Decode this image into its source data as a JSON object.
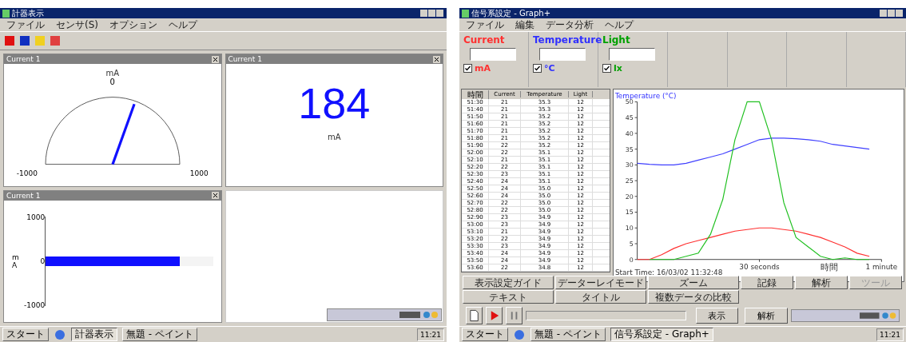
{
  "left_window": {
    "title": "計器表示",
    "menu": [
      "ファイル",
      "センサ(S)",
      "オプション",
      "ヘルプ"
    ],
    "panels": [
      {
        "kind": "gauge",
        "title": "Current 1",
        "unit": "mA",
        "value": "0",
        "min": "-1000",
        "max": "1000",
        "level": 0.61
      },
      {
        "kind": "digital",
        "title": "Current 1",
        "value": "184",
        "unit": "mA"
      },
      {
        "kind": "bar",
        "title": "Current 1",
        "ticks": [
          "1000",
          "0",
          "-1000"
        ],
        "unit": "m A",
        "level": 0.8
      }
    ],
    "taskbar": {
      "start": "スタート",
      "items": [
        {
          "label": "計器表示",
          "selected": true
        },
        {
          "label": "無題 - ペイント",
          "selected": false
        }
      ],
      "clock": "11:21"
    }
  },
  "right_window": {
    "title": "信号系設定 - Graph+",
    "menu": [
      "ファイル",
      "編集",
      "データ分析",
      "ヘルプ"
    ],
    "sensors": [
      {
        "name": "Current",
        "unit": "mA",
        "color": "#ff3030",
        "checked": true
      },
      {
        "name": "Temperature",
        "unit": "°C",
        "color": "#3030ff",
        "checked": true
      },
      {
        "name": "Light",
        "unit": "lx",
        "color": "#00a000",
        "checked": true
      }
    ],
    "table": {
      "columns": [
        "時間",
        "Current",
        "Temperature",
        "Light"
      ],
      "rows": [
        [
          "51:30",
          "21",
          "35.3",
          "12"
        ],
        [
          "51:40",
          "21",
          "35.3",
          "12"
        ],
        [
          "51:50",
          "21",
          "35.2",
          "12"
        ],
        [
          "51:60",
          "21",
          "35.2",
          "12"
        ],
        [
          "51:70",
          "21",
          "35.2",
          "12"
        ],
        [
          "51:80",
          "21",
          "35.2",
          "12"
        ],
        [
          "51:90",
          "22",
          "35.2",
          "12"
        ],
        [
          "52:00",
          "22",
          "35.1",
          "12"
        ],
        [
          "52:10",
          "21",
          "35.1",
          "12"
        ],
        [
          "52:20",
          "22",
          "35.1",
          "12"
        ],
        [
          "52:30",
          "23",
          "35.1",
          "12"
        ],
        [
          "52:40",
          "24",
          "35.1",
          "12"
        ],
        [
          "52:50",
          "24",
          "35.0",
          "12"
        ],
        [
          "52:60",
          "24",
          "35.0",
          "12"
        ],
        [
          "52:70",
          "22",
          "35.0",
          "12"
        ],
        [
          "52:80",
          "22",
          "35.0",
          "12"
        ],
        [
          "52:90",
          "23",
          "34.9",
          "12"
        ],
        [
          "53:00",
          "23",
          "34.9",
          "12"
        ],
        [
          "53:10",
          "21",
          "34.9",
          "12"
        ],
        [
          "53:20",
          "22",
          "34.9",
          "12"
        ],
        [
          "53:30",
          "23",
          "34.9",
          "12"
        ],
        [
          "53:40",
          "24",
          "34.9",
          "12"
        ],
        [
          "53:50",
          "24",
          "34.9",
          "12"
        ],
        [
          "53:60",
          "22",
          "34.8",
          "12"
        ]
      ]
    },
    "chart_data": {
      "type": "line",
      "title": "Temperature (°C)",
      "xlabel": "時間",
      "categories": [
        null,
        null,
        null,
        null,
        null,
        null,
        null,
        null,
        null,
        null,
        "30 seconds",
        null,
        null,
        null,
        null,
        null,
        null,
        null,
        null,
        null,
        "1 minute"
      ],
      "ylim": [
        0,
        50
      ],
      "yticks": [
        0,
        5,
        10,
        15,
        20,
        25,
        30,
        35,
        40,
        45,
        50
      ],
      "series": [
        {
          "color": "#4040ff",
          "values": [
            30.5,
            30.2,
            30,
            30,
            30.5,
            31.5,
            32.5,
            33.5,
            35,
            36.5,
            38,
            38.5,
            38.5,
            38.3,
            38,
            37.5,
            36.5,
            36,
            35.5,
            35,
            null
          ]
        },
        {
          "color": "#ff3030",
          "values": [
            0,
            0,
            1.5,
            3.5,
            5,
            6,
            7,
            8,
            9,
            9.5,
            10,
            10,
            9.5,
            9,
            8,
            7,
            5.5,
            4,
            2,
            1,
            null
          ]
        },
        {
          "color": "#20c020",
          "values": [
            null,
            0,
            0,
            0,
            1,
            2,
            8,
            19,
            38,
            50,
            50,
            38,
            18,
            7,
            4,
            1,
            0,
            0.5,
            0,
            0,
            null
          ]
        }
      ],
      "annotations": [
        "Start Time: 16/03/02 11:32:48"
      ]
    },
    "tool_buttons": [
      {
        "label": "表示設定ガイド",
        "disabled": false
      },
      {
        "label": "データーレイモード",
        "disabled": false
      },
      {
        "label": "ズーム",
        "disabled": false
      },
      {
        "label": "記録",
        "disabled": false
      },
      {
        "label": "解析",
        "disabled": false
      },
      {
        "label": "ツール",
        "disabled": true
      },
      {
        "label": "テキスト",
        "disabled": false
      },
      {
        "label": "タイトル",
        "disabled": false
      },
      {
        "label": "複数データの比較",
        "disabled": false
      }
    ],
    "bottom_buttons": [
      "表示",
      "解析"
    ],
    "taskbar": {
      "start": "スタート",
      "items": [
        {
          "label": "無題 - ペイント",
          "selected": false
        },
        {
          "label": "信号系設定 - Graph+",
          "selected": true
        }
      ],
      "clock": "11:21"
    }
  }
}
